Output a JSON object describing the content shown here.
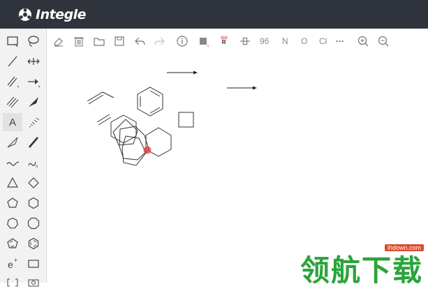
{
  "app": {
    "brand_name": "Integle"
  },
  "left_toolbar": {
    "tools": [
      {
        "name": "rectangle-select-icon"
      },
      {
        "name": "lasso-select-icon"
      },
      {
        "name": "single-bond-icon"
      },
      {
        "name": "move-icon"
      },
      {
        "name": "double-bond-icon"
      },
      {
        "name": "arrow-icon"
      },
      {
        "name": "triple-bond-icon"
      },
      {
        "name": "wedge-bond-icon"
      },
      {
        "name": "text-tool-icon",
        "label": "A"
      },
      {
        "name": "hash-bond-icon"
      },
      {
        "name": "hollow-wedge-icon"
      },
      {
        "name": "bold-bond-icon"
      },
      {
        "name": "wavy-bond-icon"
      },
      {
        "name": "chain-tool-icon"
      },
      {
        "name": "triangle-ring-icon"
      },
      {
        "name": "diamond-ring-icon"
      },
      {
        "name": "pentagon-ring-icon"
      },
      {
        "name": "hexagon-ring-icon"
      },
      {
        "name": "heptagon-ring-icon"
      },
      {
        "name": "octagon-ring-icon"
      },
      {
        "name": "cyclopentadiene-ring-icon"
      },
      {
        "name": "benzene-ring-icon"
      },
      {
        "name": "charge-tool-icon"
      },
      {
        "name": "frame-tool-icon"
      }
    ]
  },
  "top_toolbar": {
    "tools": [
      {
        "name": "eraser-icon"
      },
      {
        "name": "delete-icon"
      },
      {
        "name": "open-file-icon"
      },
      {
        "name": "save-icon"
      },
      {
        "name": "undo-icon"
      },
      {
        "name": "redo-icon"
      },
      {
        "name": "info-icon"
      },
      {
        "name": "color-square-icon"
      },
      {
        "name": "rgroup-icon",
        "label": "R"
      },
      {
        "name": "chiral-icon"
      },
      {
        "name": "element-96",
        "label": "96"
      },
      {
        "name": "element-n",
        "label": "N"
      },
      {
        "name": "element-o",
        "label": "O"
      },
      {
        "name": "element-cl",
        "label": "Cl"
      },
      {
        "name": "more-icon",
        "label": "···"
      },
      {
        "name": "zoom-in-icon"
      },
      {
        "name": "zoom-out-icon"
      }
    ]
  },
  "watermark": {
    "site": "lhdown.com",
    "text": "领航下载"
  },
  "colors": {
    "header_bg": "#2f333b",
    "toolbar_bg": "#f2f2f2",
    "highlight": "#e53935",
    "watermark_green": "#2aa43b"
  }
}
